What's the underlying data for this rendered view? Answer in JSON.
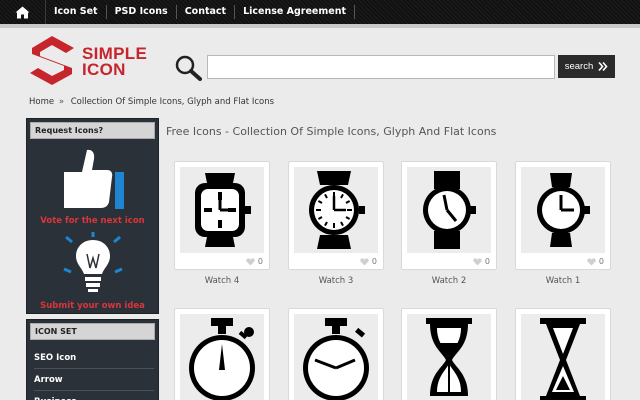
{
  "nav": {
    "home_icon": "home-icon",
    "links": [
      "Icon Set",
      "PSD Icons",
      "Contact",
      "License Agreement"
    ]
  },
  "logo": {
    "line1": "SIMPLE",
    "line2": "ICON",
    "brand_color": "#c7252c"
  },
  "search": {
    "value": "",
    "placeholder": "",
    "button_label": "search"
  },
  "breadcrumb": {
    "home": "Home",
    "separator": "»",
    "current": "Collection Of Simple Icons, Glyph and Flat Icons"
  },
  "sidebar": {
    "request_title": "Request Icons?",
    "vote_text": "Vote for the next icon",
    "submit_text": "Submit your own idea",
    "iconset_title": "ICON SET",
    "categories": [
      "SEO Icon",
      "Arrow",
      "Business"
    ]
  },
  "main": {
    "title": "Free Icons - Collection Of Simple Icons, Glyph And Flat Icons",
    "icons": [
      {
        "name": "Watch 4",
        "likes": "0",
        "icon": "wristwatch-square-icon"
      },
      {
        "name": "Watch 3",
        "likes": "0",
        "icon": "wristwatch-ticks-icon"
      },
      {
        "name": "Watch 2",
        "likes": "0",
        "icon": "wristwatch-band-icon"
      },
      {
        "name": "Watch 1",
        "likes": "0",
        "icon": "wristwatch-round-icon"
      }
    ],
    "row2_icons": [
      "stopwatch-icon",
      "stopwatch-clock-icon",
      "hourglass-icon",
      "hourglass-outline-icon"
    ]
  },
  "colors": {
    "accent_red": "#d8363b",
    "sidebar_bg": "#2b3138",
    "nav_bg": "#161616"
  }
}
